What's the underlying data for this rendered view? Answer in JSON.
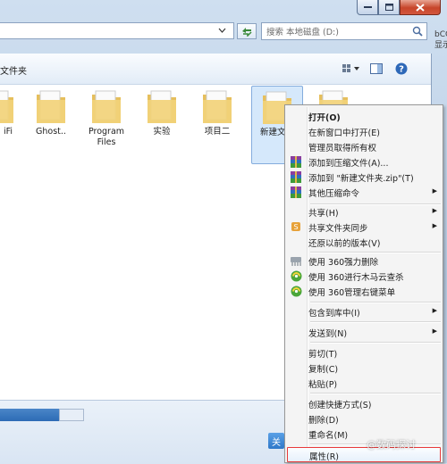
{
  "address": {
    "search_placeholder": "搜索 本地磁盘 (D:)",
    "side_fragment_1": "bCC",
    "side_fragment_2": "显示"
  },
  "toolbar": {
    "breadcrumb_fragment": "文件夹"
  },
  "folders": [
    {
      "label": "iFi"
    },
    {
      "label": "Ghost.."
    },
    {
      "label": "Program\nFiles"
    },
    {
      "label": "实验"
    },
    {
      "label": "项目二"
    },
    {
      "label": "新建文件"
    },
    {
      "label": ""
    }
  ],
  "bottom": {
    "button_fragment": "关"
  },
  "context_menu": {
    "items": [
      {
        "label": "打开(O)",
        "bold": true
      },
      {
        "label": "在新窗口中打开(E)"
      },
      {
        "label": "管理员取得所有权"
      },
      {
        "label": "添加到压缩文件(A)...",
        "icon": "winrar-icon"
      },
      {
        "label": "添加到 \"新建文件夹.zip\"(T)",
        "icon": "winrar-icon"
      },
      {
        "label": "其他压缩命令",
        "icon": "winrar-icon",
        "submenu": true
      },
      {
        "label": "共享(H)",
        "submenu": true
      },
      {
        "label": "共享文件夹同步",
        "icon": "sync-icon",
        "submenu": true
      },
      {
        "label": "还原以前的版本(V)"
      },
      {
        "label": "使用 360强力删除",
        "icon": "shredder-icon"
      },
      {
        "label": "使用 360进行木马云查杀",
        "icon": "360-icon"
      },
      {
        "label": "使用 360管理右键菜单",
        "icon": "360-icon"
      },
      {
        "label": "包含到库中(I)",
        "submenu": true
      },
      {
        "label": "发送到(N)",
        "submenu": true
      },
      {
        "label": "剪切(T)"
      },
      {
        "label": "复制(C)"
      },
      {
        "label": "粘贴(P)"
      },
      {
        "label": "创建快捷方式(S)"
      },
      {
        "label": "删除(D)"
      },
      {
        "label": "重命名(M)"
      },
      {
        "label": "属性(R)"
      }
    ]
  },
  "watermark": "@数码探讨",
  "colors": {
    "highlight_border": "#e83a3a",
    "folder_yellow": "#f2d27a"
  }
}
